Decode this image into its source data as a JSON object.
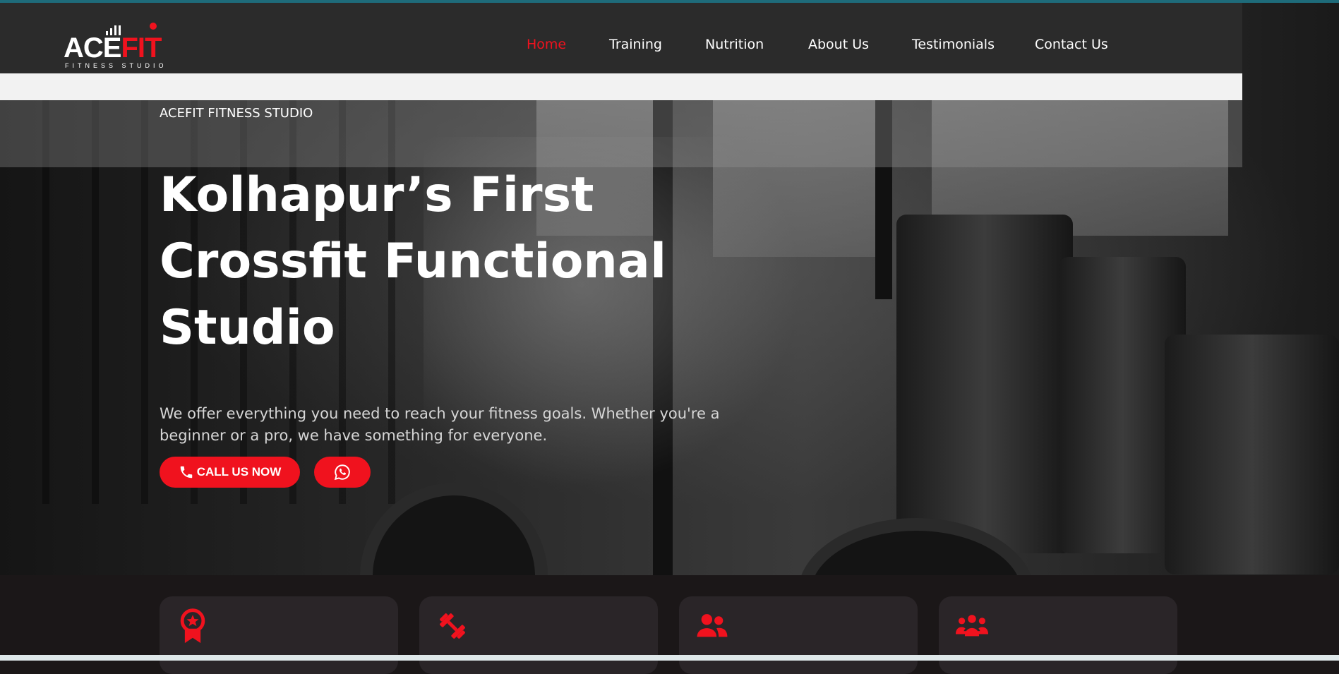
{
  "brand": {
    "logo_main": "ACE",
    "logo_accent": "FIT",
    "logo_subtitle": "FITNESS STUDIO"
  },
  "nav": {
    "items": [
      {
        "label": "Home",
        "active": true
      },
      {
        "label": "Training",
        "active": false
      },
      {
        "label": "Nutrition",
        "active": false
      },
      {
        "label": "About Us",
        "active": false
      },
      {
        "label": "Testimonials",
        "active": false
      },
      {
        "label": "Contact Us",
        "active": false
      }
    ]
  },
  "hero": {
    "kicker": "ACEFIT FITNESS STUDIO",
    "headline_lines": [
      "Kolhapur’s First",
      "Crossfit Functional",
      "Studio"
    ],
    "description": "We offer everything you need to reach your fitness goals. Whether you're a beginner or a pro, we have something for everyone.",
    "call_button_label": "CALL US NOW",
    "call_icon": "phone-icon",
    "whatsapp_icon": "whatsapp-icon"
  },
  "features": {
    "card_icons": [
      "award-icon",
      "dumbbell-icon",
      "users-icon",
      "group-icon"
    ]
  },
  "colors": {
    "accent": "#f0121e",
    "nav_bg": "#2b2b2b",
    "card_bg": "#2a2528",
    "page_bg": "#1b1718"
  }
}
